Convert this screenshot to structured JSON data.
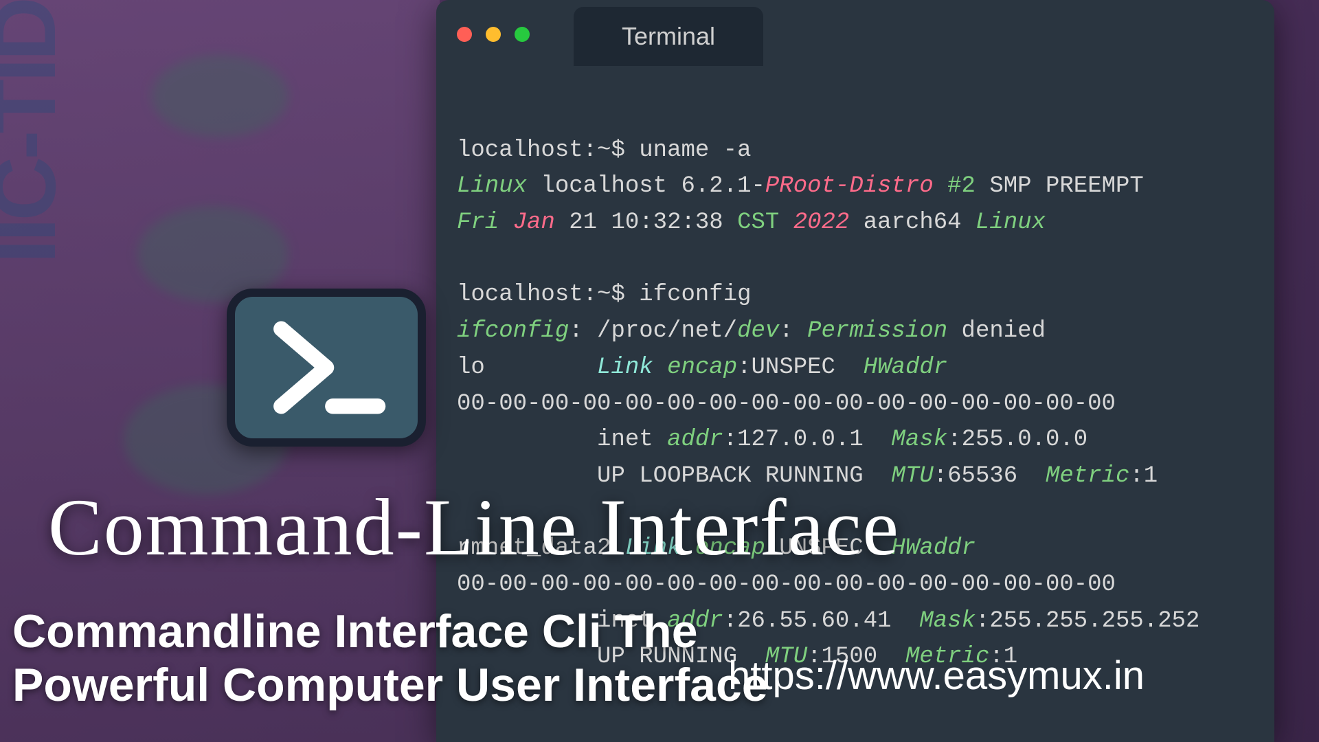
{
  "window": {
    "tab_title": "Terminal"
  },
  "prompt": {
    "user_host": "localhost",
    "sep": ":~$"
  },
  "cmd1": {
    "command": "uname -a",
    "out": {
      "os": "Linux",
      "host": "localhost",
      "ver": "6.2.1-",
      "distro": "PRoot-Distro",
      "build": "#2",
      "flags": "SMP PREEMPT",
      "day": "Fri",
      "mon": "Jan",
      "date_time": "21 10:32:38",
      "tz": "CST",
      "year": "2022",
      "arch": "aarch64",
      "os2": "Linux"
    }
  },
  "cmd2": {
    "command": "ifconfig",
    "err": {
      "prog": "ifconfig",
      "path": ": /proc/net/",
      "dev": "dev",
      "colon": ": ",
      "perm": "Permission",
      "denied": " denied"
    },
    "if_lo": {
      "name": "lo",
      "link": "Link",
      "encap_lbl": "encap",
      "encap_val": ":UNSPEC  ",
      "hwaddr": "HWaddr",
      "mac": "00-00-00-00-00-00-00-00-00-00-00-00-00-00-00-00",
      "inet": "inet ",
      "addr_lbl": "addr",
      "addr_val": ":127.0.0.1  ",
      "mask_lbl": "Mask",
      "mask_val": ":255.0.0.0",
      "flags": "UP LOOPBACK RUNNING  ",
      "mtu_lbl": "MTU",
      "mtu_val": ":65536  ",
      "metric_lbl": "Metric",
      "metric_val": ":1"
    },
    "if_rm": {
      "name": "rmnet_data2",
      "link": "Link",
      "encap_lbl": "encap",
      "encap_val": ":UNSPEC  ",
      "hwaddr": "HWaddr",
      "mac": "00-00-00-00-00-00-00-00-00-00-00-00-00-00-00-00",
      "inet": "inet ",
      "addr_lbl": "addr",
      "addr_val": ":26.55.60.41  ",
      "mask_lbl": "Mask",
      "mask_val": ":255.255.255.252",
      "flags": "UP RUNNING  ",
      "mtu_lbl": "MTU",
      "mtu_val": ":1500  ",
      "metric_lbl": "Metric",
      "metric_val": ":1"
    }
  },
  "overlay": {
    "title": "Command-Line Interface",
    "subtitle": "Commandline Interface Cli The Powerful Computer User Interface",
    "url": "https://www.easymux.in"
  },
  "side_text": "IIC-TID"
}
